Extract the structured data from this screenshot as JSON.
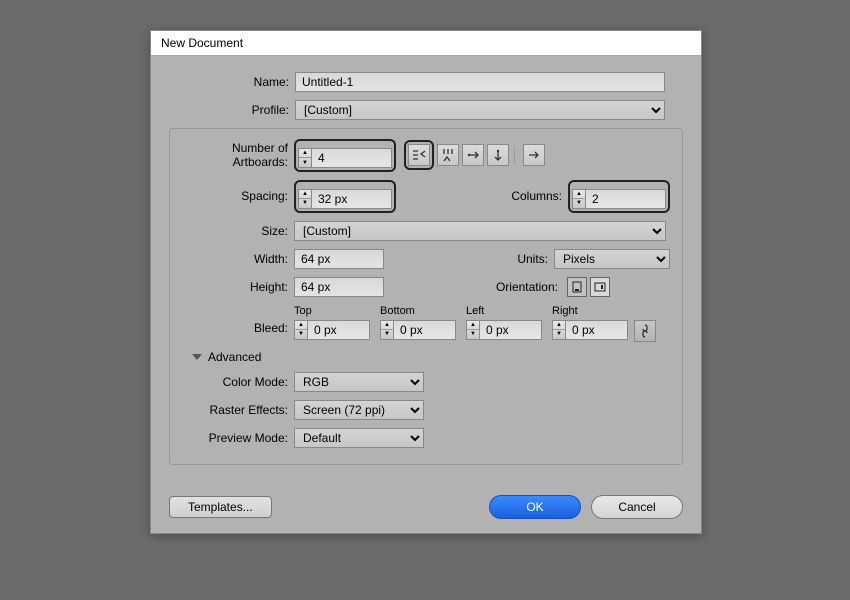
{
  "dialog": {
    "title": "New Document"
  },
  "name": {
    "label": "Name:",
    "value": "Untitled-1"
  },
  "profile": {
    "label": "Profile:",
    "value": "[Custom]"
  },
  "artboards": {
    "label": "Number of Artboards:",
    "value": "4",
    "spacing_label": "Spacing:",
    "spacing_value": "32 px",
    "columns_label": "Columns:",
    "columns_value": "2"
  },
  "size": {
    "label": "Size:",
    "value": "[Custom]"
  },
  "width": {
    "label": "Width:",
    "value": "64 px"
  },
  "height": {
    "label": "Height:",
    "value": "64 px"
  },
  "units": {
    "label": "Units:",
    "value": "Pixels"
  },
  "orientation": {
    "label": "Orientation:"
  },
  "bleed": {
    "label": "Bleed:",
    "top": {
      "label": "Top",
      "value": "0 px"
    },
    "bottom": {
      "label": "Bottom",
      "value": "0 px"
    },
    "left": {
      "label": "Left",
      "value": "0 px"
    },
    "right": {
      "label": "Right",
      "value": "0 px"
    }
  },
  "advanced": {
    "header": "Advanced",
    "color_mode": {
      "label": "Color Mode:",
      "value": "RGB"
    },
    "raster": {
      "label": "Raster Effects:",
      "value": "Screen (72 ppi)"
    },
    "preview": {
      "label": "Preview Mode:",
      "value": "Default"
    }
  },
  "footer": {
    "templates": "Templates...",
    "ok": "OK",
    "cancel": "Cancel"
  }
}
